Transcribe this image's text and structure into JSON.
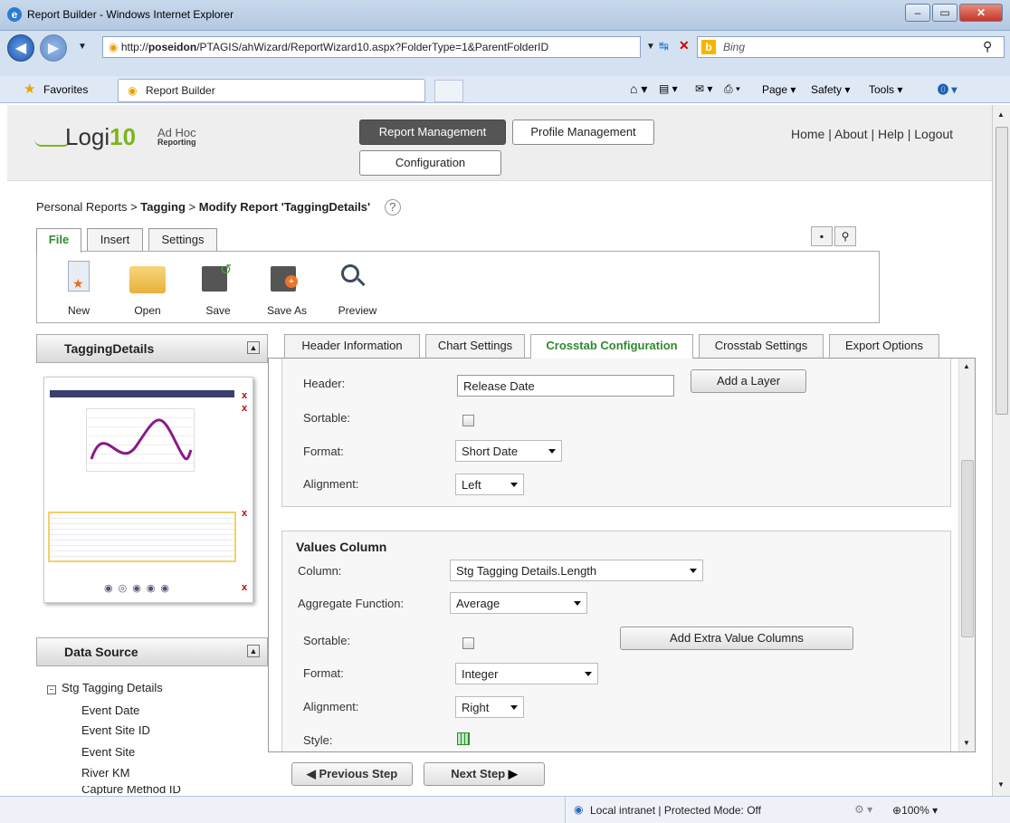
{
  "window": {
    "title": "Report Builder - Windows Internet Explorer"
  },
  "browser": {
    "url_prefix": "http://",
    "url_host": "poseidon",
    "url_rest": "/PTAGIS/ahWizard/ReportWizard10.aspx?FolderType=1&ParentFolderID",
    "search_placeholder": "Bing",
    "favorites_label": "Favorites",
    "tab_label": "Report Builder",
    "toolbar": {
      "page": "Page",
      "safety": "Safety",
      "tools": "Tools"
    }
  },
  "app": {
    "logo": {
      "name": "Logi",
      "version": "10",
      "sub1": "Ad Hoc",
      "sub2": "Reporting"
    },
    "header_buttons": {
      "report_management": "Report Management",
      "profile_management": "Profile Management",
      "configuration": "Configuration"
    },
    "header_links": {
      "home": "Home",
      "about": "About",
      "help": "Help",
      "logout": "Logout",
      "sep": "|"
    },
    "breadcrumb": {
      "a": "Personal Reports",
      "sep": ">",
      "b": "Tagging",
      "c": "Modify Report 'TaggingDetails'",
      "help": "?"
    },
    "ribbon_tabs": [
      "File",
      "Insert",
      "Settings"
    ],
    "ribbon_items": [
      "New",
      "Open",
      "Save",
      "Save As",
      "Preview"
    ]
  },
  "left": {
    "preview_title": "TaggingDetails",
    "data_source_title": "Data Source",
    "data_source_root": "Stg Tagging Details",
    "data_source_items": [
      "Event Date",
      "Event Site ID",
      "Event Site",
      "River KM",
      "Capture Method ID"
    ]
  },
  "tabs": [
    "Header Information",
    "Chart Settings",
    "Crosstab Configuration",
    "Crosstab Settings",
    "Export Options"
  ],
  "active_tab": "Crosstab Configuration",
  "header_section": {
    "header_label": "Header:",
    "header_value": "Release Date",
    "add_layer": "Add a Layer",
    "sortable_label": "Sortable:",
    "format_label": "Format:",
    "format_value": "Short Date",
    "alignment_label": "Alignment:",
    "alignment_value": "Left"
  },
  "values_section": {
    "title": "Values Column",
    "column_label": "Column:",
    "column_value": "Stg Tagging Details.Length",
    "agg_label": "Aggregate Function:",
    "agg_value": "Average",
    "sortable_label": "Sortable:",
    "add_extra": "Add Extra Value Columns",
    "format_label": "Format:",
    "format_value": "Integer",
    "alignment_label": "Alignment:",
    "alignment_value": "Right",
    "style_label": "Style:"
  },
  "nav": {
    "previous": "Previous Step",
    "next": "Next Step"
  },
  "status": {
    "zone": "Local intranet | Protected Mode: Off",
    "zoom": "100%"
  },
  "colors": {
    "accent_green": "#2e8b2e",
    "header_dark": "#555555"
  }
}
